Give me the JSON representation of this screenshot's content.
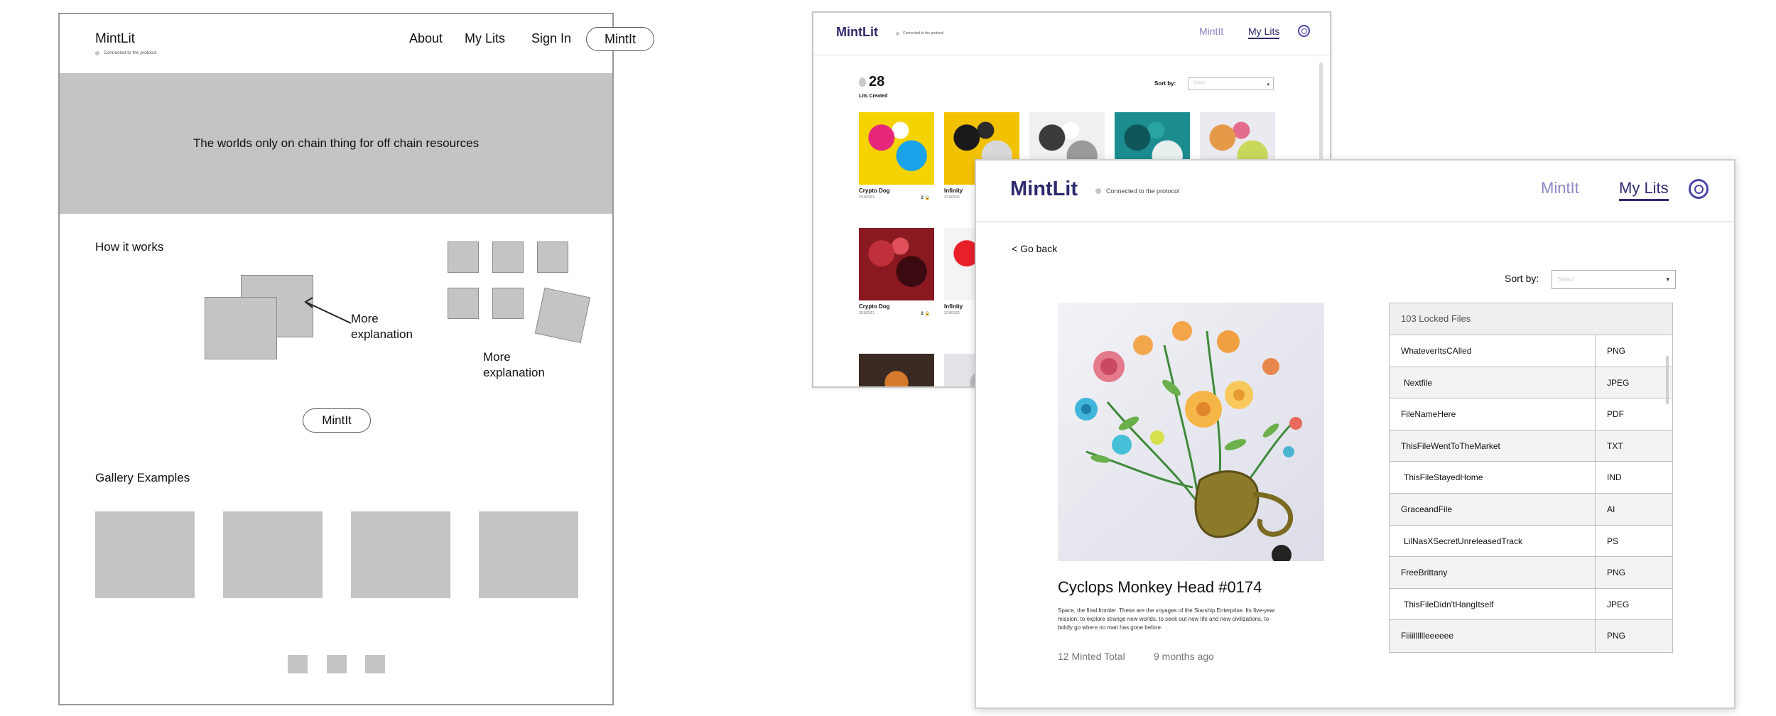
{
  "wireframe": {
    "logo": "MintLit",
    "status": "Connected to the protocol",
    "nav": {
      "about": "About",
      "my_lits": "My Lits",
      "sign_in": "Sign In",
      "mint_button": "MintIt"
    },
    "hero_text": "The worlds only on chain thing for off chain resources",
    "how_it_works": "How it works",
    "explanation_1": "More explanation",
    "explanation_2": "More explanation",
    "mint_button": "MintIt",
    "gallery_heading": "Gallery Examples"
  },
  "gallery_screen": {
    "logo": "MintLit",
    "status": "Connected to the protocol",
    "nav": {
      "mintit": "MintIt",
      "my_lits": "My Lits"
    },
    "count": "28",
    "count_label": "Lits Created",
    "sort_label": "Sort by:",
    "sort_placeholder": "Select",
    "cards": [
      {
        "title": "Crypto Dog",
        "date": "2/18/2021",
        "meta": "2 🔒",
        "colors": [
          "#f5d300",
          "#e6267a",
          "#1aa3e8",
          "#ffffff"
        ]
      },
      {
        "title": "Infinity",
        "date": "2/18/2021",
        "meta": "",
        "colors": [
          "#f2c200",
          "#1a1a1a",
          "#d8d8d8",
          "#2a2a2a"
        ]
      },
      {
        "title": "",
        "date": "",
        "meta": "",
        "colors": [
          "#f0f0f0",
          "#3a3a3a",
          "#9a9a9a",
          "#ffffff"
        ]
      },
      {
        "title": "",
        "date": "",
        "meta": "",
        "colors": [
          "#1b8c8f",
          "#0e5558",
          "#e8f0ef",
          "#2aa4a2"
        ]
      },
      {
        "title": "",
        "date": "",
        "meta": "",
        "colors": [
          "#eceaf1",
          "#e59a4a",
          "#c9d85a",
          "#e36b8c"
        ]
      },
      {
        "title": "Crypto Dog",
        "date": "2/18/2021",
        "meta": "2 🔒",
        "colors": [
          "#8a1820",
          "#c0303a",
          "#3a0a10",
          "#e0505a"
        ]
      },
      {
        "title": "Infinity",
        "date": "2/18/2021",
        "meta": "",
        "colors": [
          "#f4f4f4",
          "#e8202a",
          "#f5c400",
          "#ffffff"
        ]
      }
    ]
  },
  "detail_screen": {
    "logo": "MintLit",
    "status": "Connected to the protocol",
    "nav": {
      "mintit": "MintIt",
      "my_lits": "My Lits"
    },
    "go_back": "< Go back",
    "sort_label": "Sort by:",
    "sort_placeholder": "Select",
    "title": "Cyclops Monkey Head #0174",
    "description": "Space, the final frontier. These are the voyages of the Starship Enterprise. Its five-year mission: to explore strange new worlds, to seek out new life and new civilizations, to boldly go where no man has gone before.",
    "minted_total": "12 Minted Total",
    "age": "9 months ago",
    "files_header": "103 Locked Files",
    "files": [
      {
        "name": "WhateverItsCAlled",
        "type": "PNG"
      },
      {
        "name": "Nextfile",
        "type": "JPEG"
      },
      {
        "name": "FileNameHere",
        "type": "PDF"
      },
      {
        "name": "ThisFileWentToTheMarket",
        "type": "TXT"
      },
      {
        "name": "ThisFileStayedHome",
        "type": "IND"
      },
      {
        "name": "GraceandFile",
        "type": "AI"
      },
      {
        "name": "LilNasXSecretUnreleasedTrack",
        "type": "PS"
      },
      {
        "name": "FreeBrittany",
        "type": "PNG"
      },
      {
        "name": "ThisFileDidn'tHangItself",
        "type": "JPEG"
      },
      {
        "name": "Fiiiilllllleeeeee",
        "type": "PNG"
      }
    ]
  }
}
